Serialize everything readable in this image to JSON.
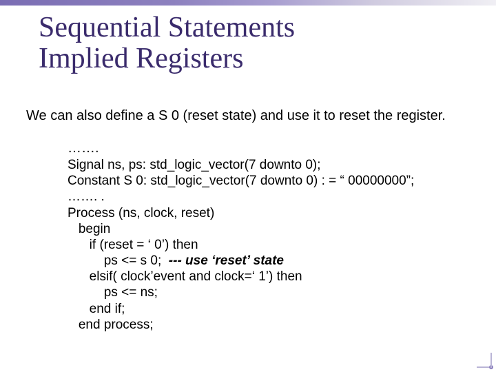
{
  "title_line1": "Sequential Statements",
  "title_line2": "Implied Registers",
  "intro": "We can also define a S 0 (reset state) and use it to reset the register.",
  "dots": "…….",
  "code": {
    "l1": "Signal ns, ps: std_logic_vector(7 downto 0);",
    "l2": "Constant S 0: std_logic_vector(7 downto 0) : = “ 00000000”;",
    "l3": "……. .",
    "l4": "Process (ns, clock, reset)",
    "l5": "   begin",
    "l6": "      if (reset = ‘ 0’) then",
    "l7a": "          ps <= s 0;  ",
    "l7b": "--- use ‘reset’ state",
    "l8": "      elsif( clock’event and clock=‘ 1’) then",
    "l9": "          ps <= ns;",
    "l10": "      end if;",
    "l11": "   end process;"
  }
}
